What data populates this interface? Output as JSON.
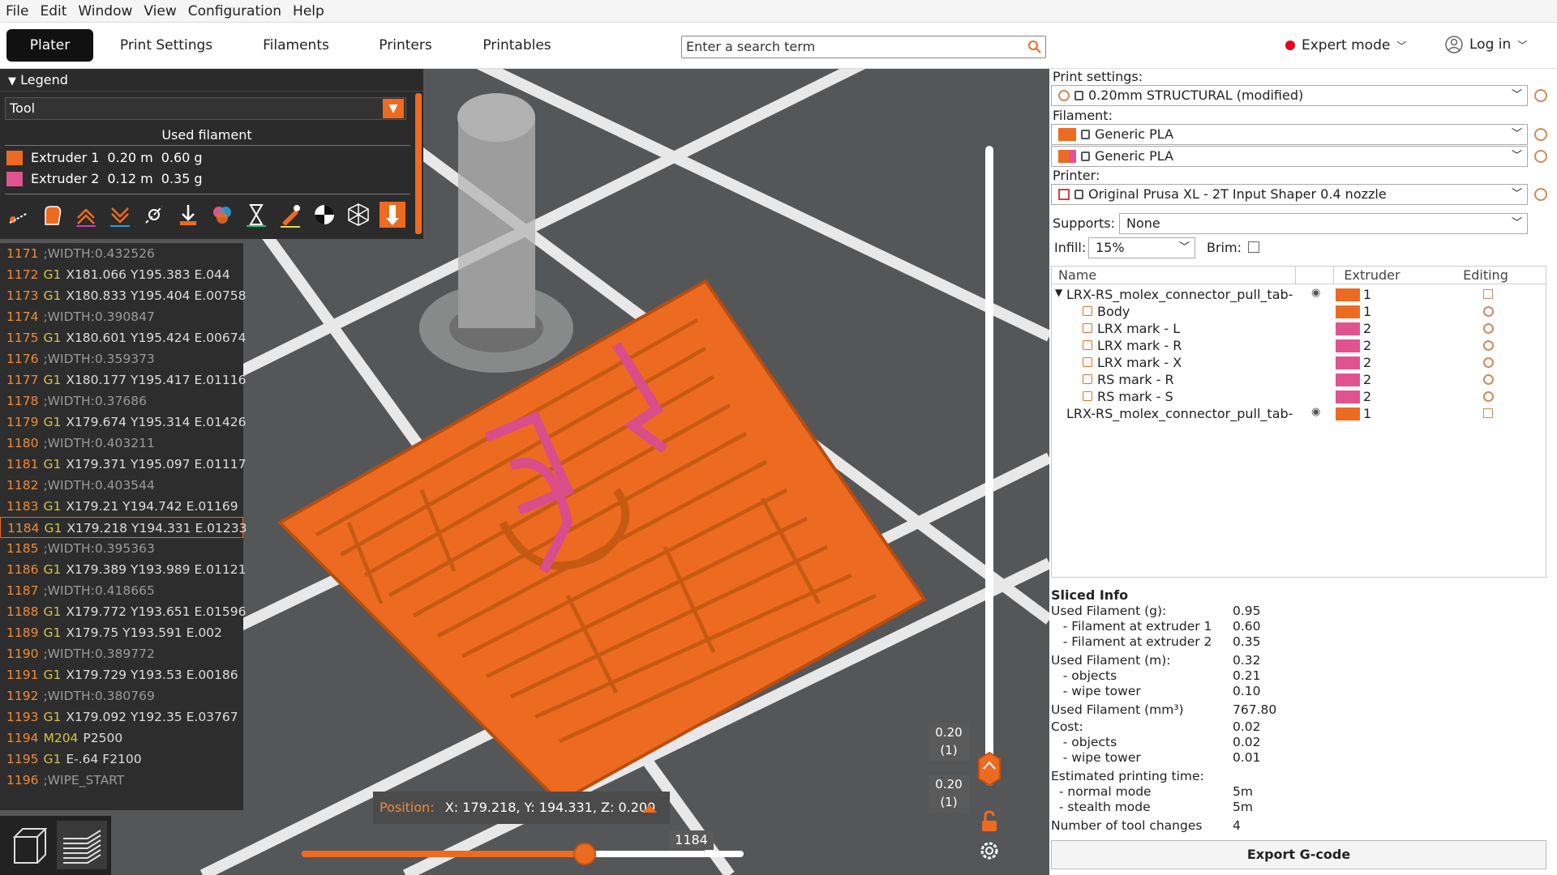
{
  "menu": [
    "File",
    "Edit",
    "Window",
    "View",
    "Configuration",
    "Help"
  ],
  "tabs": {
    "plater": "Plater",
    "print_settings": "Print Settings",
    "filaments": "Filaments",
    "printers": "Printers",
    "printables": "Printables"
  },
  "search": {
    "placeholder": "Enter a search term"
  },
  "mode": {
    "label": "Expert mode"
  },
  "login": {
    "label": "Log in"
  },
  "legend": {
    "title": "Legend",
    "view_type": "Tool",
    "used_filament_header": "Used filament",
    "extruders": [
      {
        "name": "Extruder 1",
        "length": "0.20 m",
        "weight": "0.60 g",
        "color": "#ed6b21"
      },
      {
        "name": "Extruder 2",
        "length": "0.12 m",
        "weight": "0.35 g",
        "color": "#e0538f"
      }
    ]
  },
  "gcode": [
    {
      "n": "1171",
      "cmd": "",
      "text": ";WIDTH:0.432526",
      "comment": true
    },
    {
      "n": "1172",
      "cmd": "G1",
      "text": "X181.066 Y195.383 E.044"
    },
    {
      "n": "1173",
      "cmd": "G1",
      "text": "X180.833 Y195.404 E.00758"
    },
    {
      "n": "1174",
      "cmd": "",
      "text": ";WIDTH:0.390847",
      "comment": true
    },
    {
      "n": "1175",
      "cmd": "G1",
      "text": "X180.601 Y195.424 E.00674"
    },
    {
      "n": "1176",
      "cmd": "",
      "text": ";WIDTH:0.359373",
      "comment": true
    },
    {
      "n": "1177",
      "cmd": "G1",
      "text": "X180.177 Y195.417 E.01116"
    },
    {
      "n": "1178",
      "cmd": "",
      "text": ";WIDTH:0.37686",
      "comment": true
    },
    {
      "n": "1179",
      "cmd": "G1",
      "text": "X179.674 Y195.314 E.01426"
    },
    {
      "n": "1180",
      "cmd": "",
      "text": ";WIDTH:0.403211",
      "comment": true
    },
    {
      "n": "1181",
      "cmd": "G1",
      "text": "X179.371 Y195.097 E.01117"
    },
    {
      "n": "1182",
      "cmd": "",
      "text": ";WIDTH:0.403544",
      "comment": true
    },
    {
      "n": "1183",
      "cmd": "G1",
      "text": "X179.21 Y194.742 E.01169"
    },
    {
      "n": "1184",
      "cmd": "G1",
      "text": "X179.218 Y194.331 E.01233",
      "selected": true
    },
    {
      "n": "1185",
      "cmd": "",
      "text": ";WIDTH:0.395363",
      "comment": true
    },
    {
      "n": "1186",
      "cmd": "G1",
      "text": "X179.389 Y193.989 E.01121"
    },
    {
      "n": "1187",
      "cmd": "",
      "text": ";WIDTH:0.418665",
      "comment": true
    },
    {
      "n": "1188",
      "cmd": "G1",
      "text": "X179.772 Y193.651 E.01596"
    },
    {
      "n": "1189",
      "cmd": "G1",
      "text": "X179.75 Y193.591 E.002"
    },
    {
      "n": "1190",
      "cmd": "",
      "text": ";WIDTH:0.389772",
      "comment": true
    },
    {
      "n": "1191",
      "cmd": "G1",
      "text": "X179.729 Y193.53 E.00186"
    },
    {
      "n": "1192",
      "cmd": "",
      "text": ";WIDTH:0.380769",
      "comment": true
    },
    {
      "n": "1193",
      "cmd": "G1",
      "text": "X179.092 Y192.35 E.03767"
    },
    {
      "n": "1194",
      "cmd": "M204",
      "text": "P2500"
    },
    {
      "n": "1195",
      "cmd": "G1",
      "text": "E-.64 F2100"
    },
    {
      "n": "1196",
      "cmd": "",
      "text": ";WIPE_START",
      "comment": true
    }
  ],
  "position": {
    "label": "Position:",
    "value": "X: 179.218, Y: 194.331, Z: 0.200"
  },
  "hslider": {
    "value": "1184",
    "fraction": 0.64
  },
  "vslider": {
    "top_label": "0.20",
    "top_sub": "(1)",
    "bottom_label": "0.20",
    "bottom_sub": "(1)"
  },
  "settings": {
    "print_label": "Print settings:",
    "print_value": "0.20mm STRUCTURAL (modified)",
    "filament_label": "Filament:",
    "filament_1": "Generic PLA",
    "filament_2": "Generic PLA",
    "printer_label": "Printer:",
    "printer_value": "Original Prusa XL - 2T Input Shaper 0.4 nozzle",
    "supports_label": "Supports:",
    "supports_value": "None",
    "infill_label": "Infill:",
    "infill_value": "15%",
    "brim_label": "Brim:"
  },
  "objects": {
    "headers": {
      "name": "Name",
      "extruder": "Extruder",
      "editing": "Editing"
    },
    "rows": [
      {
        "name": "LRX-RS_molex_connector_pull_tab-",
        "ext": "1",
        "level": 0,
        "color": "#ed6b21"
      },
      {
        "name": "Body",
        "ext": "1",
        "level": 1,
        "color": "#ed6b21"
      },
      {
        "name": "LRX mark - L",
        "ext": "2",
        "level": 1,
        "color": "#e0538f"
      },
      {
        "name": "LRX mark - R",
        "ext": "2",
        "level": 1,
        "color": "#e0538f"
      },
      {
        "name": "LRX mark - X",
        "ext": "2",
        "level": 1,
        "color": "#e0538f"
      },
      {
        "name": "RS mark - R",
        "ext": "2",
        "level": 1,
        "color": "#e0538f"
      },
      {
        "name": "RS mark - S",
        "ext": "2",
        "level": 1,
        "color": "#e0538f"
      },
      {
        "name": "LRX-RS_molex_connector_pull_tab-",
        "ext": "1",
        "level": 0,
        "color": "#ed6b21"
      }
    ]
  },
  "sliced": {
    "title": "Sliced Info",
    "rows": [
      {
        "k": "Used Filament (g):",
        "v": "0.95"
      },
      {
        "k": "   - Filament at extruder 1",
        "v": "0.60"
      },
      {
        "k": "   - Filament at extruder 2",
        "v": "0.35"
      },
      {
        "k": "Used Filament (m):",
        "v": "0.32"
      },
      {
        "k": "   - objects",
        "v": "0.21"
      },
      {
        "k": "   - wipe tower",
        "v": "0.10"
      },
      {
        "k": "Used Filament (mm³)",
        "v": "767.80"
      },
      {
        "k": "Cost:",
        "v": "0.02"
      },
      {
        "k": "   - objects",
        "v": "0.02"
      },
      {
        "k": "   - wipe tower",
        "v": "0.01"
      },
      {
        "k": "Estimated printing time:",
        "v": ""
      },
      {
        "k": "  - normal mode",
        "v": "5m"
      },
      {
        "k": "  - stealth mode",
        "v": "5m"
      },
      {
        "k": "Number of tool changes",
        "v": "4"
      }
    ]
  },
  "export": {
    "label": "Export G-code"
  },
  "colors": {
    "accent": "#ed6b21",
    "extruder2": "#e0538f",
    "viewport": "#555658"
  }
}
